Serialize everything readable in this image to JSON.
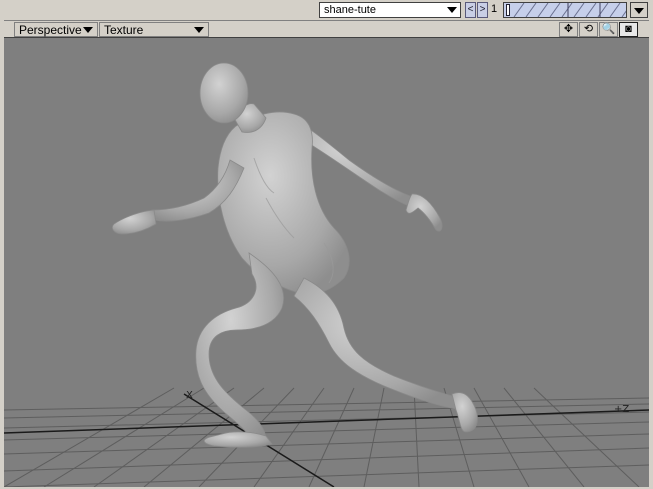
{
  "topbar": {
    "scene_name": "shane-tute",
    "prev_label": "<",
    "next_label": ">",
    "frame": "1"
  },
  "viewport_header": {
    "view_mode": "Perspective",
    "render_mode": "Texture"
  },
  "tools": [
    {
      "name": "move-view",
      "glyph": "✥"
    },
    {
      "name": "rotate-view",
      "glyph": "⟲"
    },
    {
      "name": "zoom-view",
      "glyph": "🔍"
    },
    {
      "name": "maximize-view",
      "glyph": "◙"
    }
  ],
  "axes": {
    "x_label": "X",
    "z_label": "+Z"
  },
  "colors": {
    "viewport_bg": "#7f7f7f",
    "ui_bg": "#d4d0c8",
    "grid": "#5a5a5a",
    "figure": "#b9b9b9"
  }
}
